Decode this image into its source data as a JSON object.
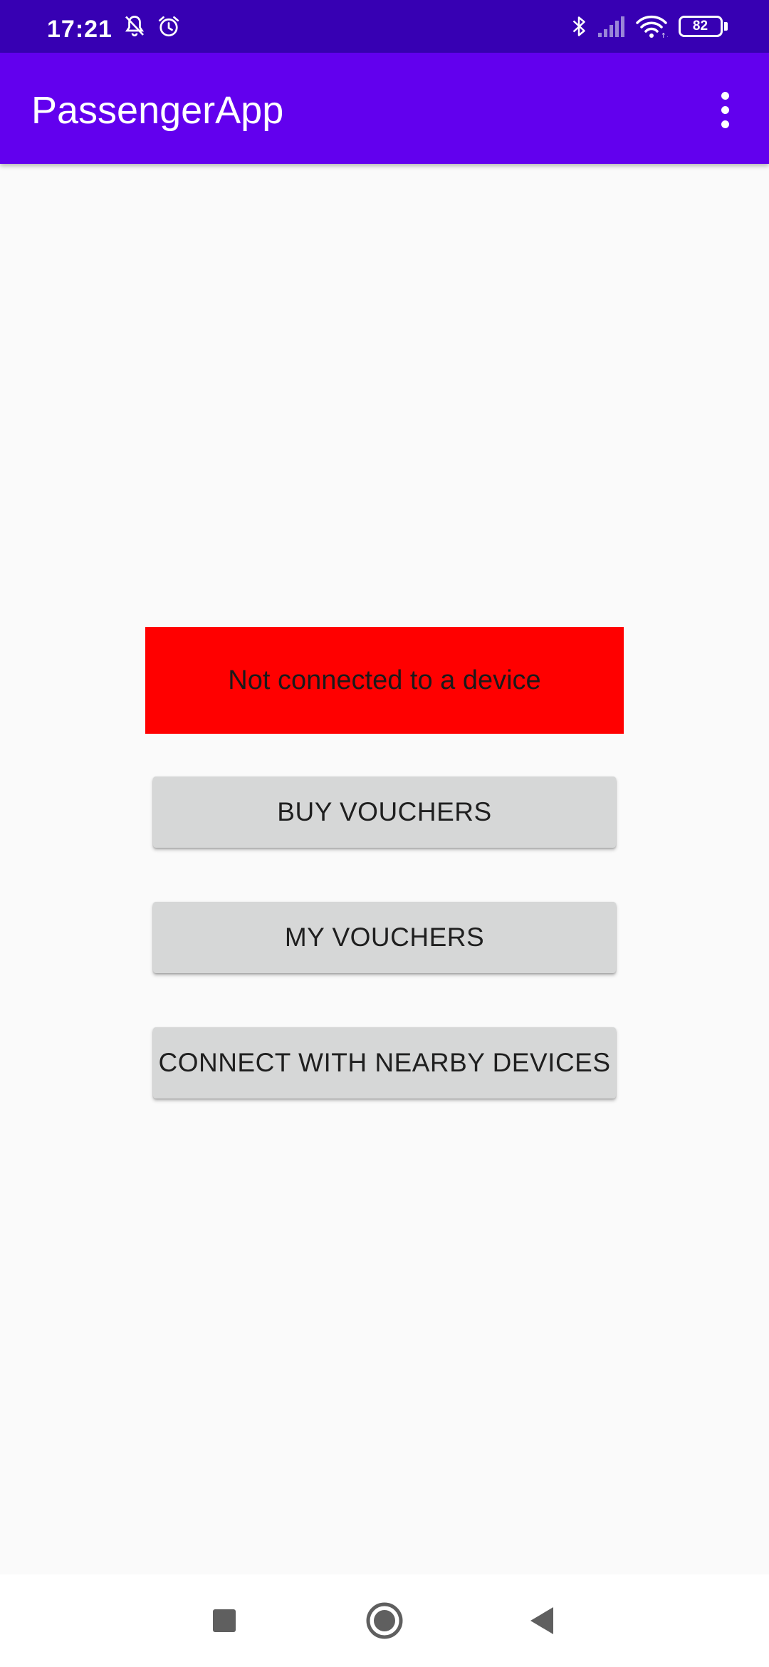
{
  "status_bar": {
    "time": "17:21",
    "battery_level": "82",
    "icons": [
      "bell-off-icon",
      "alarm-icon",
      "bluetooth-icon",
      "cellular-signal-icon",
      "wifi-icon",
      "battery-icon"
    ]
  },
  "app_bar": {
    "title": "PassengerApp",
    "menu_icon": "more-vert-icon"
  },
  "main": {
    "connection_status": "Not connected to a device",
    "buttons": {
      "buy_vouchers": "BUY VOUCHERS",
      "my_vouchers": "MY VOUCHERS",
      "connect_nearby": "CONNECT WITH NEARBY DEVICES"
    }
  },
  "nav_bar": {
    "icons": [
      "recents-icon",
      "home-icon",
      "back-icon"
    ]
  },
  "colors": {
    "status_bar": "#3700b3",
    "app_bar": "#6200ee",
    "status_banner": "#ff0000",
    "button": "#d6d7d7",
    "background": "#fafafa"
  }
}
